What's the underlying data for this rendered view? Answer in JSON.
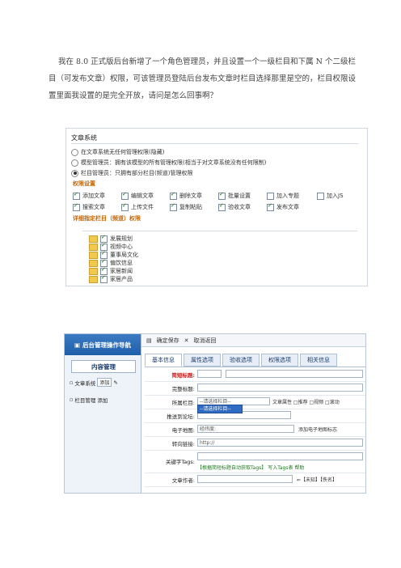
{
  "question": "我在 8.0 正式版后台新增了一个角色管理员，并且设置一个一级栏目和下属 N 个二级栏目（可发布文章）权限，可该管理员登陆后台发布文章时栏目选择那里是空的，栏目权限设置里面我设置的是完全开放，请问是怎么回事啊？",
  "screenshot1": {
    "section_title": "文章系统",
    "radio_options": [
      {
        "label": "在文章系统无任何管理权限(隐藏)",
        "selected": false
      },
      {
        "label": "模型管理员：拥有该模型的所有管理权限(相当于对文章系统没有任何限制)",
        "selected": false
      },
      {
        "label": "栏目管理员：只拥有部分栏目(频道)管理权限",
        "selected": true
      }
    ],
    "permissions_title": "权限设置",
    "permissions": [
      {
        "label": "添加文章",
        "checked": true
      },
      {
        "label": "编辑文章",
        "checked": true
      },
      {
        "label": "删除文章",
        "checked": true
      },
      {
        "label": "批量设置",
        "checked": true
      },
      {
        "label": "加入专题",
        "checked": false
      },
      {
        "label": "加入JS",
        "checked": false
      },
      {
        "label": "搜索文章",
        "checked": true
      },
      {
        "label": "上传文件",
        "checked": true
      },
      {
        "label": "复制粘贴",
        "checked": true
      },
      {
        "label": "验收文章",
        "checked": true
      },
      {
        "label": "发布文章",
        "checked": true
      }
    ],
    "channel_title": "详细指定栏目（频道）权限",
    "channels": [
      "发展规划",
      "视频中心",
      "董事局文化",
      "偏饮信息",
      "家居新闻",
      "家居产品"
    ]
  },
  "screenshot2": {
    "nav_title": "后台管理操作导航",
    "manage_button": "内容管理",
    "nav_links": [
      {
        "label": "文章系统",
        "action": "添加"
      },
      {
        "label": "栏目管理",
        "action": "添加"
      }
    ],
    "toolbar": {
      "confirm": "确定保存",
      "cancel": "取消返回"
    },
    "tabs": [
      "基本信息",
      "属性选项",
      "验收选项",
      "权限选项",
      "相关信息"
    ],
    "fields": [
      {
        "label": "简短标题:",
        "red": true,
        "value": "",
        "extra": ""
      },
      {
        "label": "完整标题:",
        "red": false,
        "value": "",
        "extra": ""
      },
      {
        "label": "所属栏目:",
        "red": false,
        "value": "--请选择栏目--",
        "extra": "文章属性 □推荐 □视频 □滚动"
      },
      {
        "label": "推送到论坛:",
        "red": false,
        "value": "",
        "extra": ""
      },
      {
        "label": "电子地图:",
        "red": false,
        "value": "经纬度:",
        "extra": "添加电子地图标志"
      },
      {
        "label": "转向链接:",
        "red": false,
        "value": "http://",
        "extra": ""
      },
      {
        "label": "关键字Tags:",
        "red": false,
        "value": "",
        "extra": "【根据简短标题自动获取Tags】 写入Tags表 帮助"
      },
      {
        "label": "文章作者:",
        "red": false,
        "value": "",
        "extra": "⇐【未知】【佚名】"
      }
    ],
    "dropdown_option": "--请选择栏目--"
  }
}
